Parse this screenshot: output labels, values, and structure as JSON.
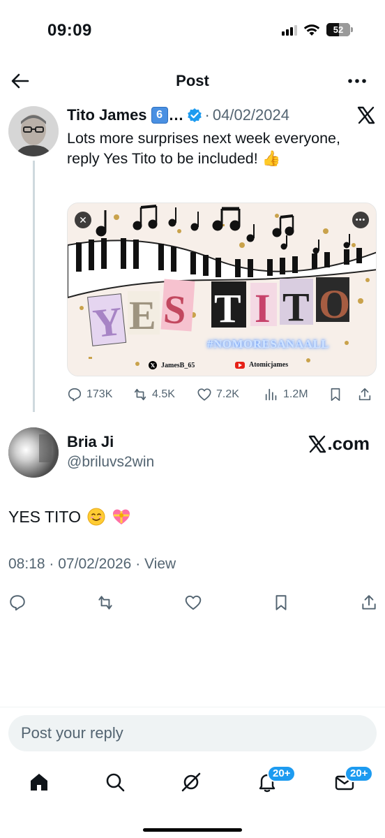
{
  "status_bar": {
    "time": "09:09",
    "battery": "52",
    "battery_level": 0.52
  },
  "header": {
    "title": "Post",
    "back_icon": "arrow-left-icon",
    "more_icon": "more-horizontal-icon"
  },
  "parent_post": {
    "author_name": "Tito James",
    "badge": "6",
    "ellipsis": "…",
    "separator": "·",
    "date": "04/02/2024",
    "text": "Lots more surprises next week everyone, reply Yes Tito to be included! 👍",
    "media": {
      "title": "YES TITO",
      "hashtag": "#NOMORESANAALL",
      "credit_x": "JamesB_65",
      "credit_youtube": "Atomicjames"
    },
    "stats": {
      "replies": "173K",
      "reposts": "4.5K",
      "likes": "7.2K",
      "views": "1.2M"
    }
  },
  "main_post": {
    "author_name": "Bria Ji",
    "handle": "@briluvs2win",
    "source": ".com",
    "text": "YES TITO",
    "time": "08:18",
    "date": "07/02/2026",
    "separator": "·",
    "view_label": "View"
  },
  "reply": {
    "placeholder": "Post your reply"
  },
  "nav": {
    "notifications_badge": "20+",
    "messages_badge": "20+"
  },
  "colors": {
    "accent": "#1d9bf0",
    "text": "#0f1419",
    "secondary": "#536471"
  }
}
